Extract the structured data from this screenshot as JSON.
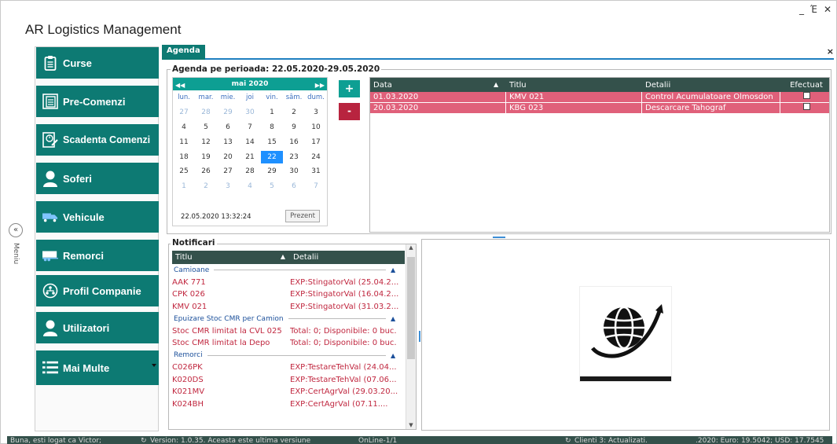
{
  "app": {
    "title": "AR Logistics Management"
  },
  "window_controls": {
    "minimize": "_",
    "maximize": "Έ",
    "close": "✕"
  },
  "sidebar": {
    "collapse_icon": "«",
    "menu_label": "Meniu",
    "items": [
      {
        "label": "Curse",
        "icon": "clipboard-icon"
      },
      {
        "label": "Pre-Comenzi",
        "icon": "list-icon"
      },
      {
        "label": "Scadenta Comenzi",
        "icon": "deadline-icon"
      },
      {
        "label": "Soferi",
        "icon": "driver-icon"
      },
      {
        "label": "Vehicule",
        "icon": "truck-icon"
      },
      {
        "label": "Remorci",
        "icon": "trailer-icon"
      },
      {
        "label": "Profil Companie",
        "icon": "company-icon"
      },
      {
        "label": "Utilizatori",
        "icon": "users-icon"
      },
      {
        "label": "Mai Multe",
        "icon": "more-icon"
      }
    ]
  },
  "tabs": {
    "active": "Agenda",
    "close": "×"
  },
  "agenda": {
    "title": "Agenda pe perioada: 22.05.2020-29.05.2020",
    "calendar": {
      "month": "mai 2020",
      "weekdays": [
        "lun.",
        "mar.",
        "mie.",
        "joi",
        "vin.",
        "sâm.",
        "dum."
      ],
      "weeks": [
        [
          "27",
          "28",
          "29",
          "30",
          "1",
          "2",
          "3"
        ],
        [
          "4",
          "5",
          "6",
          "7",
          "8",
          "9",
          "10"
        ],
        [
          "11",
          "12",
          "13",
          "14",
          "15",
          "16",
          "17"
        ],
        [
          "18",
          "19",
          "20",
          "21",
          "22",
          "23",
          "24"
        ],
        [
          "25",
          "26",
          "27",
          "28",
          "29",
          "30",
          "31"
        ],
        [
          "1",
          "2",
          "3",
          "4",
          "5",
          "6",
          "7"
        ]
      ],
      "selected": "22",
      "datetime": "22.05.2020 13:32:24",
      "today_button": "Prezent"
    },
    "add_button": "+",
    "delete_button": "-",
    "grid": {
      "columns": [
        "Data",
        "Titlu",
        "Detalii",
        "Efectuat"
      ],
      "rows": [
        {
          "data": "01.03.2020",
          "titlu": "KMV 021",
          "detalii": "Control Acumulatoare Olmosdon",
          "efectuat": false
        },
        {
          "data": "20.03.2020",
          "titlu": "KBG 023",
          "detalii": "Descarcare Tahograf",
          "efectuat": false
        }
      ]
    }
  },
  "notificari": {
    "title": "Notificari",
    "columns": [
      "Titlu",
      "Detalii"
    ],
    "groups": [
      {
        "name": "Camioane",
        "rows": [
          {
            "titlu": "AAK 771",
            "detalii": "EXP:StingatorVal (25.04.2..."
          },
          {
            "titlu": "CPK 026",
            "detalii": "EXP:StingatorVal (16.04.2..."
          },
          {
            "titlu": "KMV 021",
            "detalii": "EXP:StingatorVal (31.03.2..."
          }
        ]
      },
      {
        "name": "Epuizare Stoc CMR per Camion",
        "rows": [
          {
            "titlu": "Stoc CMR limitat la CVL 025",
            "detalii": "Total: 0; Disponibile: 0 buc."
          },
          {
            "titlu": "Stoc CMR limitat la Depo",
            "detalii": "Total: 0; Disponibile: 0 buc."
          }
        ]
      },
      {
        "name": "Remorci",
        "rows": [
          {
            "titlu": "C026PK",
            "detalii": "EXP:TestareTehVal (24.04..."
          },
          {
            "titlu": "K020DS",
            "detalii": "EXP:TestareTehVal (07.06..."
          },
          {
            "titlu": "K021MV",
            "detalii": "EXP:CertAgrVal (29.03.20..."
          },
          {
            "titlu": "K024BH",
            "detalii": "EXP:CertAgrVal (07.11...."
          }
        ]
      }
    ]
  },
  "status": {
    "user": "Buna, esti logat ca Victor;",
    "version": "Version: 1.0.35. Aceasta este ultima versiune",
    "online": "OnLine-1/1",
    "clients": "Clienti 3: Actualizati.",
    "rates": ".2020: Euro: 19.5042; USD: 17.7545"
  },
  "colors": {
    "accent": "#0d7a73",
    "header": "#34514b",
    "alert_row": "#e0607a",
    "alert_text": "#c0273f"
  }
}
